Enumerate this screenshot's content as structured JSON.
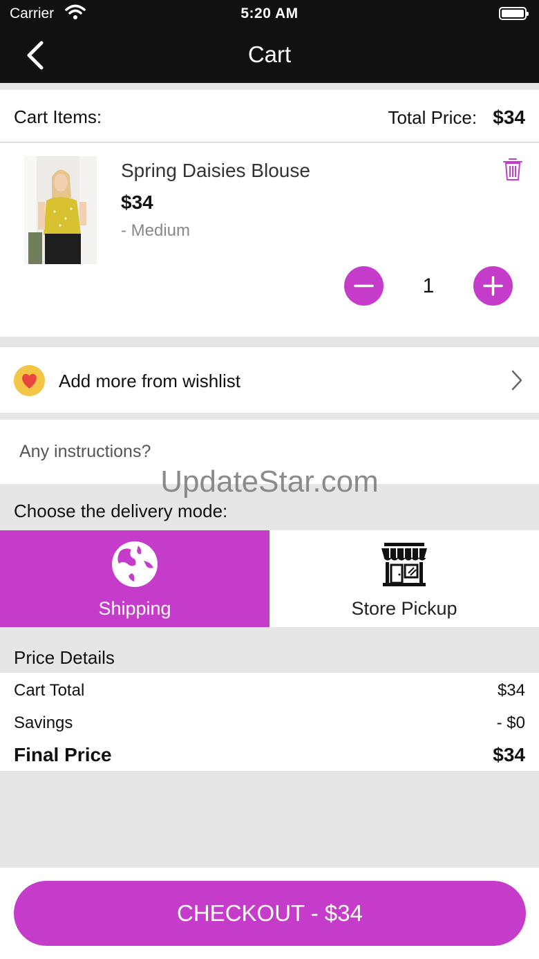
{
  "status_bar": {
    "carrier": "Carrier",
    "time": "5:20 AM"
  },
  "nav": {
    "title": "Cart"
  },
  "cart_header": {
    "items_label": "Cart Items:",
    "total_label": "Total Price:",
    "total_value": "$34"
  },
  "item": {
    "name": "Spring Daisies Blouse",
    "price": "$34",
    "variant": "- Medium",
    "quantity": "1"
  },
  "wishlist": {
    "label": "Add more from wishlist"
  },
  "instructions": {
    "placeholder": "Any instructions?"
  },
  "watermark": "UpdateStar.com",
  "delivery": {
    "title": "Choose the delivery mode:",
    "modes": [
      {
        "label": "Shipping",
        "selected": true
      },
      {
        "label": "Store Pickup",
        "selected": false
      }
    ]
  },
  "price_details": {
    "title": "Price Details",
    "rows": [
      {
        "label": "Cart Total",
        "value": "$34"
      },
      {
        "label": "Savings",
        "value": "- $0"
      },
      {
        "label": "Final Price",
        "value": "$34"
      }
    ]
  },
  "checkout": {
    "label": "CHECKOUT - $34"
  },
  "colors": {
    "accent": "#c53ccb",
    "nav_bg": "#111111",
    "page_bg": "#e6e6e6"
  }
}
